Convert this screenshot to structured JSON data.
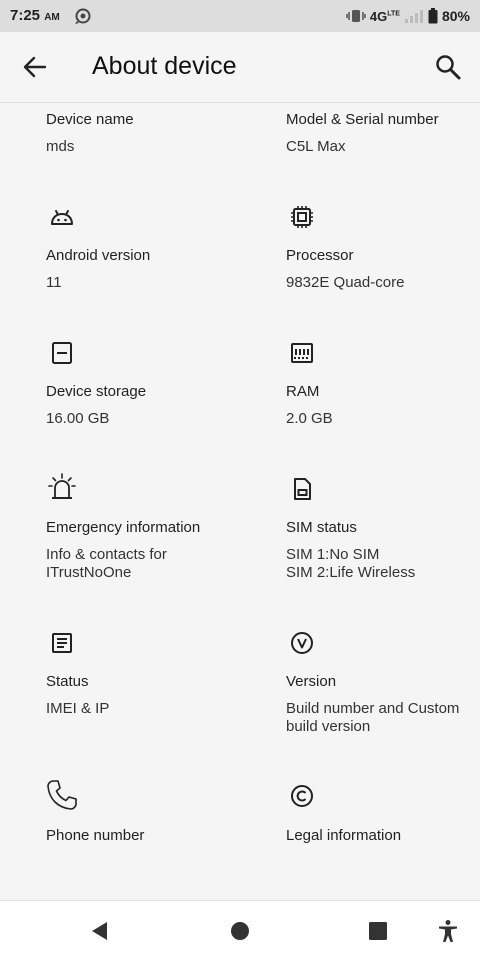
{
  "status_bar": {
    "time": "7:25",
    "ampm": "AM",
    "network": "4G",
    "network_sup": "LTE",
    "battery": "80%",
    "icons": [
      "sync-icon",
      "vibrate-icon",
      "signal-icon",
      "battery-icon"
    ]
  },
  "app_bar": {
    "title": "About device",
    "back_icon": "back-arrow-icon",
    "search_icon": "search-icon"
  },
  "items": [
    {
      "label": "Device name",
      "value": "mds"
    },
    {
      "label": "Model & Serial number",
      "value": "C5L Max"
    },
    {
      "label": "Android version",
      "value": "11",
      "icon": "android-icon"
    },
    {
      "label": "Processor",
      "value": "9832E Quad-core",
      "icon": "processor-icon"
    },
    {
      "label": "Device storage",
      "value": "16.00 GB",
      "icon": "storage-icon"
    },
    {
      "label": "RAM",
      "value": "2.0 GB",
      "icon": "ram-icon"
    },
    {
      "label": "Emergency information",
      "value_line1": "Info & contacts for",
      "value_line2": "ITrustNoOne",
      "icon": "emergency-alarm-icon"
    },
    {
      "label": "SIM status",
      "value_line1": "SIM 1:No SIM",
      "value_line2": "SIM 2:Life Wireless",
      "icon": "sim-card-icon"
    },
    {
      "label": "Status",
      "value": "IMEI & IP",
      "icon": "status-list-icon"
    },
    {
      "label": "Version",
      "value_line1": "Build number and Custom",
      "value_line2": "build version",
      "icon": "version-icon"
    },
    {
      "label": "Phone number",
      "icon": "phone-icon"
    },
    {
      "label": "Legal information",
      "icon": "copyright-icon"
    }
  ],
  "nav_bar": {
    "icons": [
      "back-triangle-icon",
      "home-circle-icon",
      "recents-square-icon",
      "accessibility-icon"
    ]
  }
}
